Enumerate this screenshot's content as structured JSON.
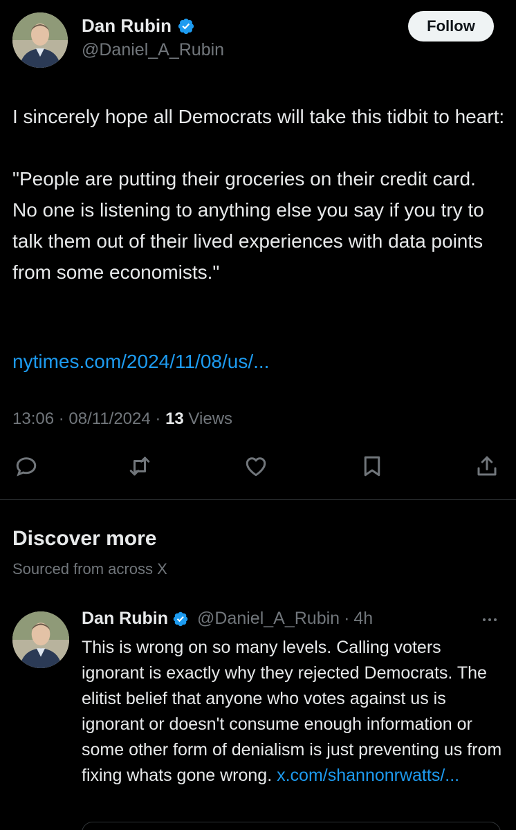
{
  "main_tweet": {
    "author_name": "Dan Rubin",
    "handle": "@Daniel_A_Rubin",
    "follow_label": "Follow",
    "text": "I sincerely hope all Democrats will take this tidbit to heart:\n\n\"People are putting their groceries on their credit card. No one is listening to anything else you say if you try to talk them out of their lived experiences with data points from some economists.\"",
    "link": "nytimes.com/2024/11/08/us/...",
    "time": "13:06",
    "sep1": " · ",
    "date": "08/11/2024",
    "sep2": " · ",
    "views_count": "13",
    "views_label": " Views"
  },
  "actions": {
    "reply_icon": "reply-icon",
    "retweet_icon": "retweet-icon",
    "like_icon": "heart-icon",
    "bookmark_icon": "bookmark-icon",
    "share_icon": "share-icon"
  },
  "discover": {
    "title": "Discover more",
    "subtitle": "Sourced from across X"
  },
  "recommended_tweet": {
    "author_name": "Dan Rubin",
    "handle": "@Daniel_A_Rubin",
    "dot": "·",
    "time": "4h",
    "text": "This is wrong on so many levels. Calling voters ignorant is exactly why they rejected Democrats. The elitist belief that anyone who votes against us is ignorant or doesn't consume enough information or some other form of denialism is just preventing us from fixing whats gone wrong. ",
    "link": "x.com/shannonrwatts/..."
  },
  "colors": {
    "background": "#000000",
    "text": "#e7e9ea",
    "secondary": "#71767b",
    "link": "#1d9bf0",
    "verified": "#1d9bf0"
  }
}
